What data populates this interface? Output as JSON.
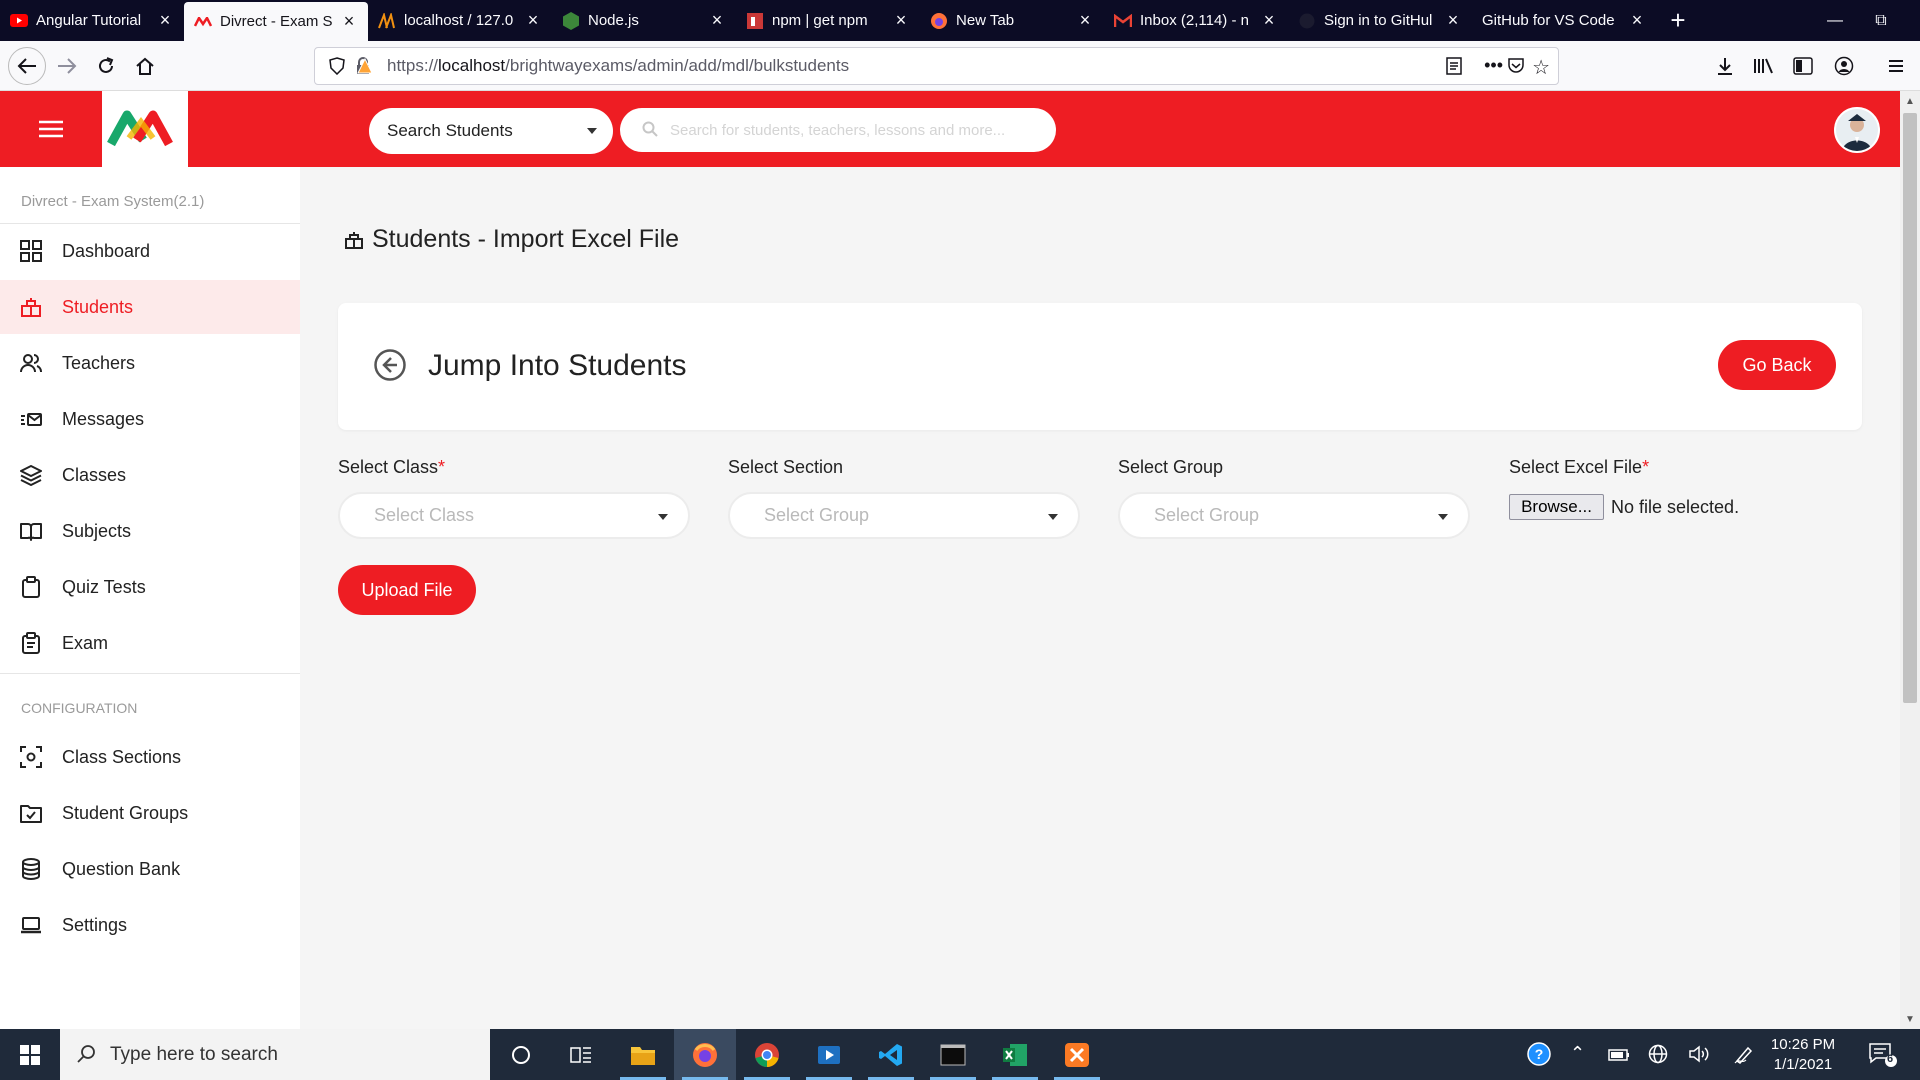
{
  "browser": {
    "tabs": [
      {
        "label": "Angular Tutorial",
        "favicon": "youtube-icon",
        "color": "#ff0000"
      },
      {
        "label": "Divrect - Exam S",
        "favicon": "divrect-logo-icon",
        "color": "#ee1d23",
        "active": true
      },
      {
        "label": "localhost / 127.0",
        "favicon": "phpmyadmin-icon",
        "color": "#f29111"
      },
      {
        "label": "Node.js",
        "favicon": "nodejs-icon",
        "color": "#3c873a"
      },
      {
        "label": "npm | get npm",
        "favicon": "npm-icon",
        "color": "#cb3837"
      },
      {
        "label": "New Tab",
        "favicon": "firefox-icon",
        "color": "#ff7139"
      },
      {
        "label": "Inbox (2,114) - n",
        "favicon": "gmail-icon",
        "color": "#ea4335"
      },
      {
        "label": "Sign in to GitHul",
        "favicon": "github-icon",
        "color": "#0c0c25"
      },
      {
        "label": "GitHub for VS Code",
        "favicon": "none",
        "color": "#0c0c25"
      }
    ],
    "url_prefix": "https://",
    "url_host": "localhost",
    "url_path": "/brightwayexams/admin/add/mdl/bulkstudents"
  },
  "header": {
    "search_scope": "Search Students",
    "search_placeholder": "Search for students, teachers, lessons and more...",
    "brand_color": "#ee1d23"
  },
  "sidebar": {
    "version": "Divrect - Exam System(2.1)",
    "items": [
      {
        "label": "Dashboard",
        "icon": "dashboard-grid-icon"
      },
      {
        "label": "Students",
        "icon": "students-icon",
        "active": true
      },
      {
        "label": "Teachers",
        "icon": "teachers-icon"
      },
      {
        "label": "Messages",
        "icon": "messages-icon"
      },
      {
        "label": "Classes",
        "icon": "layers-icon"
      },
      {
        "label": "Subjects",
        "icon": "book-icon"
      },
      {
        "label": "Quiz Tests",
        "icon": "clipboard-icon"
      },
      {
        "label": "Exam",
        "icon": "exam-clipboard-icon"
      }
    ],
    "config_heading": "CONFIGURATION",
    "config_items": [
      {
        "label": "Class Sections",
        "icon": "focus-icon"
      },
      {
        "label": "Student Groups",
        "icon": "folder-check-icon"
      },
      {
        "label": "Question Bank",
        "icon": "database-icon"
      },
      {
        "label": "Settings",
        "icon": "laptop-icon"
      }
    ]
  },
  "main": {
    "page_title": "Students - Import Excel File",
    "card_title": "Jump Into Students",
    "go_back": "Go Back",
    "fields": {
      "class_label": "Select Class",
      "class_placeholder": "Select Class",
      "section_label": "Select Section",
      "section_placeholder": "Select Group",
      "group_label": "Select Group",
      "group_placeholder": "Select Group",
      "file_label": "Select Excel File",
      "browse": "Browse...",
      "file_status": "No file selected.",
      "required_mark": "*"
    },
    "upload": "Upload File"
  },
  "taskbar": {
    "search_placeholder": "Type here to search",
    "time": "10:26 PM",
    "date": "1/1/2021",
    "notifications": "6"
  }
}
